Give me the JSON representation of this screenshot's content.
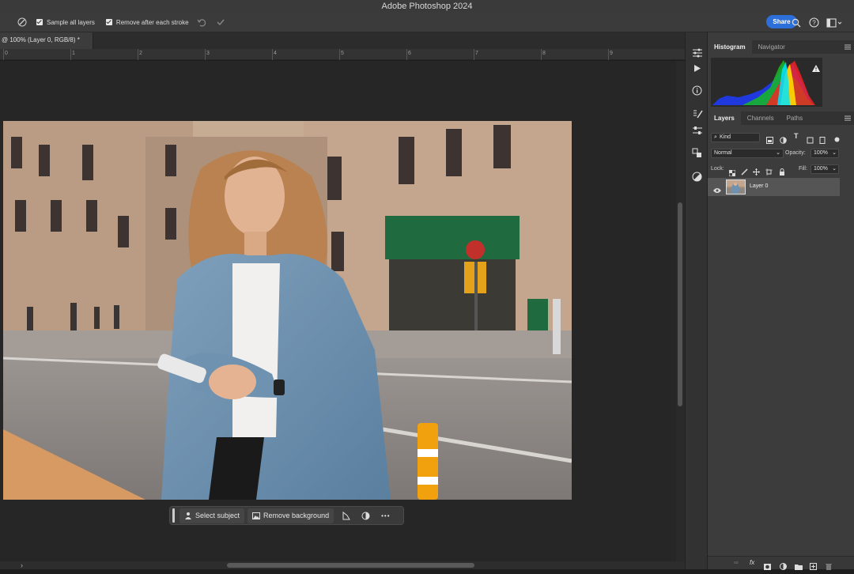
{
  "app": {
    "title": "Adobe Photoshop 2024"
  },
  "options_bar": {
    "sample_all_layers": "Sample all layers",
    "remove_after_stroke": "Remove after each stroke",
    "share": "Share"
  },
  "document": {
    "tab_title": "@ 100% (Layer 0, RGB/8) *"
  },
  "ruler": {
    "ticks": [
      "0",
      "1",
      "2",
      "3",
      "4",
      "5",
      "6",
      "7",
      "8",
      "9"
    ]
  },
  "context_bar": {
    "select_subject": "Select subject",
    "remove_background": "Remove background",
    "more": "•••"
  },
  "panels": {
    "top_tabs": [
      "Histogram",
      "Navigator"
    ],
    "layer_tabs": [
      "Layers",
      "Channels",
      "Paths"
    ],
    "kind": "Kind",
    "blend_mode": "Normal",
    "opacity_label": "Opacity:",
    "opacity_value": "100%",
    "lock_label": "Lock:",
    "fill_label": "Fill:",
    "fill_value": "100%",
    "layer_name": "Layer 0"
  },
  "colors": {
    "accent": "#2c6fd8",
    "panel": "#3c3c3c",
    "canvas": "#262626"
  }
}
